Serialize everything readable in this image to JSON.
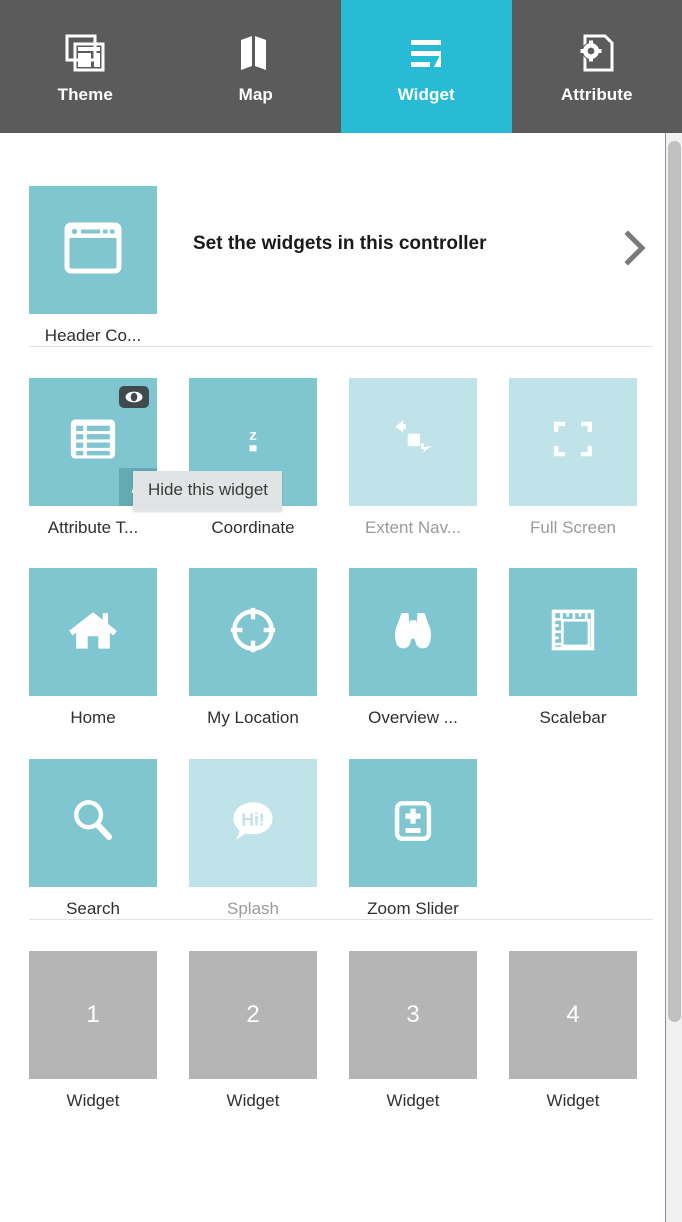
{
  "tabs": [
    {
      "label": "Theme",
      "icon": "theme-icon",
      "active": false
    },
    {
      "label": "Map",
      "icon": "map-icon",
      "active": false
    },
    {
      "label": "Widget",
      "icon": "widget-icon",
      "active": true
    },
    {
      "label": "Attribute",
      "icon": "attribute-icon",
      "active": false
    }
  ],
  "header_controller": {
    "tile_label": "Header Co...",
    "description": "Set the widgets in this controller",
    "chevron": "chevron-right-icon",
    "icon": "browser-window-icon"
  },
  "tooltip": {
    "text": "Hide this widget"
  },
  "widgets": [
    {
      "label": "Attribute T...",
      "icon": "list-table-icon",
      "disabled": false,
      "has_eye_badge": true,
      "has_pencil_badge": true
    },
    {
      "label": "Coordinate",
      "icon": "coordinate-icon",
      "disabled": false,
      "has_eye_badge": false,
      "has_pencil_badge": false
    },
    {
      "label": "Extent Nav...",
      "icon": "extent-nav-icon",
      "disabled": true,
      "has_eye_badge": false,
      "has_pencil_badge": false
    },
    {
      "label": "Full Screen",
      "icon": "full-screen-icon",
      "disabled": true,
      "has_eye_badge": false,
      "has_pencil_badge": false
    },
    {
      "label": "Home",
      "icon": "home-icon",
      "disabled": false,
      "has_eye_badge": false,
      "has_pencil_badge": false
    },
    {
      "label": "My Location",
      "icon": "my-location-icon",
      "disabled": false,
      "has_eye_badge": false,
      "has_pencil_badge": false
    },
    {
      "label": "Overview ...",
      "icon": "binoculars-icon",
      "disabled": false,
      "has_eye_badge": false,
      "has_pencil_badge": false
    },
    {
      "label": "Scalebar",
      "icon": "scalebar-icon",
      "disabled": false,
      "has_eye_badge": false,
      "has_pencil_badge": false
    },
    {
      "label": "Search",
      "icon": "search-icon",
      "disabled": false,
      "has_eye_badge": false,
      "has_pencil_badge": false
    },
    {
      "label": "Splash",
      "icon": "splash-icon",
      "disabled": true,
      "has_eye_badge": false,
      "has_pencil_badge": false
    },
    {
      "label": "Zoom Slider",
      "icon": "zoom-slider-icon",
      "disabled": false,
      "has_eye_badge": false,
      "has_pencil_badge": false
    }
  ],
  "placeholders": [
    {
      "number": "1",
      "label": "Widget"
    },
    {
      "number": "2",
      "label": "Widget"
    },
    {
      "number": "3",
      "label": "Widget"
    },
    {
      "number": "4",
      "label": "Widget"
    }
  ],
  "colors": {
    "tabbar_bg": "#5b5b5b",
    "active_tab": "#28bbd5",
    "tile_teal": "#7fc6d0",
    "tile_teal_disabled": "#bfe3e8",
    "placeholder_gray": "#b5b5b5",
    "tooltip_bg": "#e1e4e4",
    "label_text": "#2f2f2f",
    "label_text_dim": "#9b9b9b"
  }
}
